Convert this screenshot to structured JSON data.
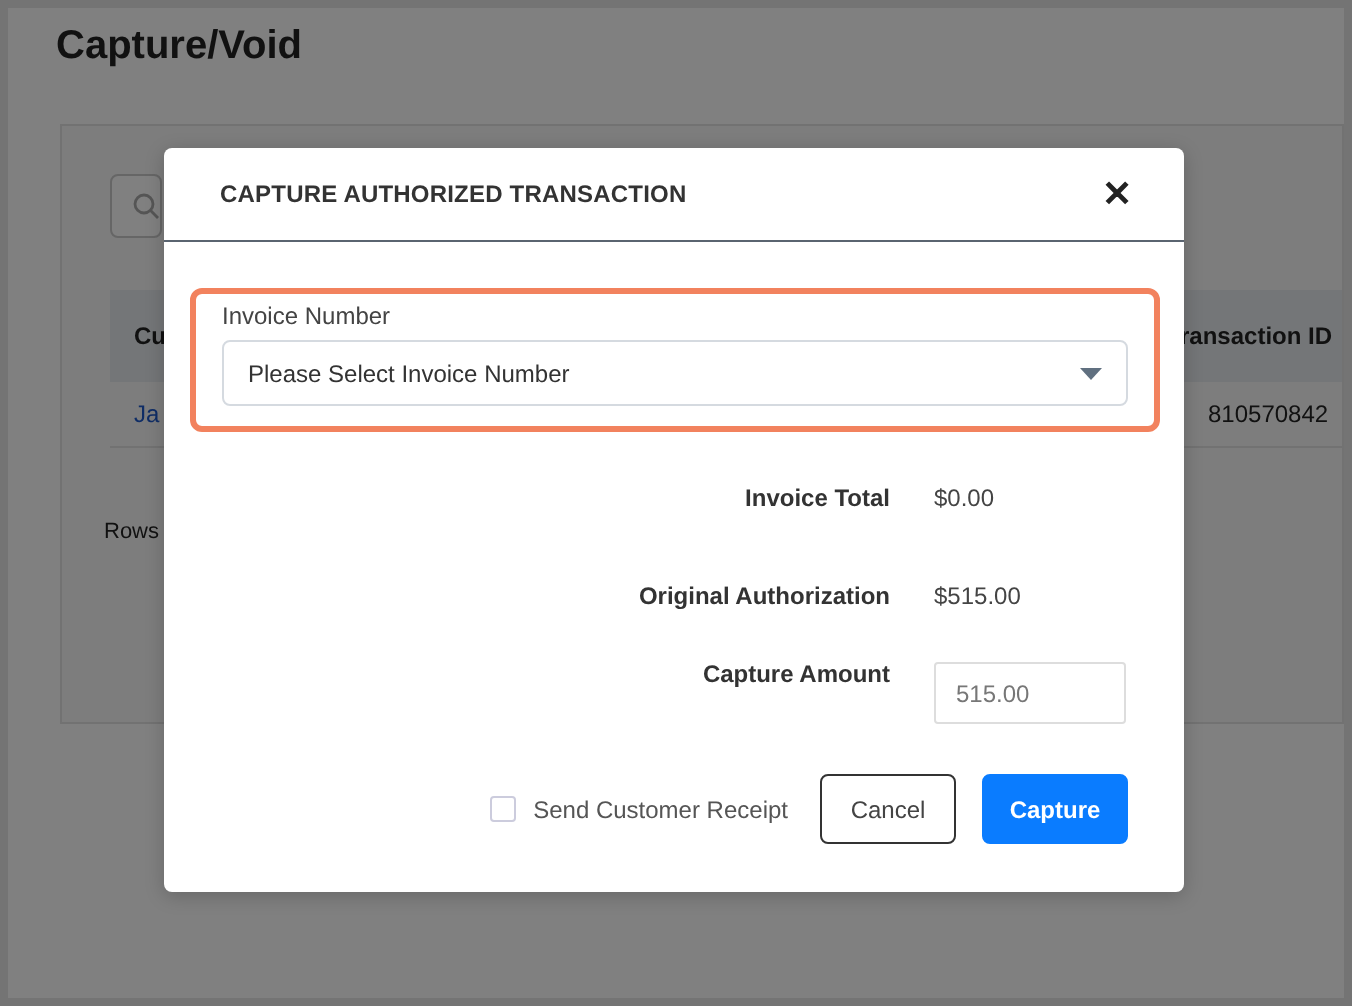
{
  "page": {
    "title": "Capture/Void",
    "table": {
      "columns": [
        "Cu",
        "ransaction ID"
      ],
      "rows": [
        [
          "Ja",
          "810570842"
        ]
      ]
    },
    "footer_text": "Rows"
  },
  "dialog": {
    "title": "CAPTURE AUTHORIZED TRANSACTION",
    "close": "✕",
    "invoice": {
      "label": "Invoice Number",
      "placeholder": "Please Select Invoice Number",
      "highlighted": true
    },
    "summary": [
      {
        "label": "Invoice Total",
        "value": "$0.00",
        "kind": "text"
      },
      {
        "label": "Original Authorization",
        "value": "$515.00",
        "kind": "text"
      },
      {
        "label": "Capture Amount",
        "value": "515.00",
        "kind": "input"
      }
    ],
    "receipt": {
      "label": "Send Customer Receipt",
      "checked": false
    },
    "buttons": [
      {
        "label": "Cancel",
        "kind": "secondary"
      },
      {
        "label": "Capture",
        "kind": "primary"
      }
    ]
  }
}
